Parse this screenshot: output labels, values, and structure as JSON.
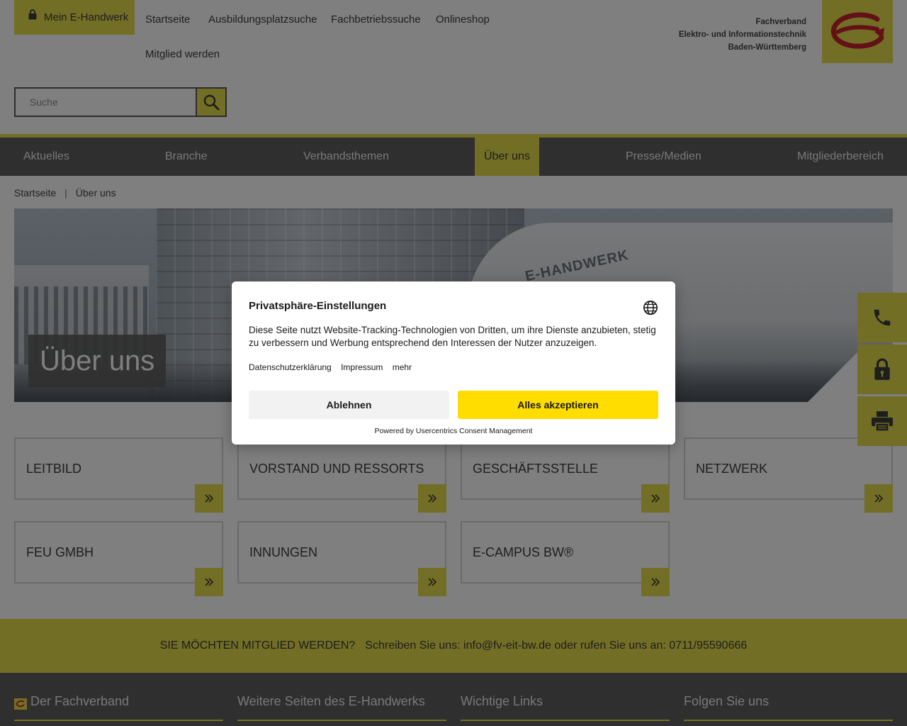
{
  "header": {
    "login_label": "Mein E-Handwerk",
    "topnav": [
      "Startseite",
      "Ausbildungsplatzsuche",
      "Fachbetriebssuche",
      "Onlineshop",
      "Mitglied werden"
    ],
    "brand_lines": [
      "Fachverband",
      "Elektro- und Informationstechnik",
      "Baden-Württemberg"
    ],
    "accent_color": "#e5dc4b"
  },
  "search": {
    "placeholder": "Suche"
  },
  "mainnav": {
    "items": [
      "Aktuelles",
      "Branche",
      "Verbandsthemen",
      "Über uns",
      "Presse/Medien",
      "Mitgliederbereich"
    ],
    "active": "Über uns"
  },
  "breadcrumb": {
    "items": [
      "Startseite",
      "Über uns"
    ],
    "separator": "|"
  },
  "hero": {
    "title": "Über uns",
    "van_text": "E-HANDWERK"
  },
  "side_buttons": [
    "phone-icon",
    "lock-icon",
    "printer-icon"
  ],
  "tiles": [
    {
      "label": "LEITBILD"
    },
    {
      "label": "VORSTAND UND RESSORTS"
    },
    {
      "label": "GESCHÄFTSSTELLE"
    },
    {
      "label": "NETZWERK"
    },
    {
      "label": "FEU GMBH"
    },
    {
      "label": "INNUNGEN"
    },
    {
      "label": "E-CAMPUS BW®"
    }
  ],
  "member_banner": {
    "question": "SIE MÖCHTEN MITGLIED WERDEN?",
    "text": "Schreiben Sie uns: info@fv-eit-bw.de oder rufen Sie uns an: 0711/95590666"
  },
  "footer": {
    "columns": [
      "Der Fachverband",
      "Weitere Seiten des E-Handwerks",
      "Wichtige Links",
      "Folgen Sie uns"
    ]
  },
  "consent": {
    "title": "Privatsphäre-Einstellungen",
    "description": "Diese Seite nutzt Website-Tracking-Technologien von Dritten, um ihre Dienste anzubieten, stetig zu verbessern und Werbung entsprechend den Interessen der Nutzer anzuzeigen.",
    "links": [
      "Datenschutzerklärung",
      "Impressum",
      "mehr"
    ],
    "deny_label": "Ablehnen",
    "accept_label": "Alles akzeptieren",
    "powered_by": "Powered by Usercentrics Consent Management",
    "accept_color": "#ffdd00"
  }
}
